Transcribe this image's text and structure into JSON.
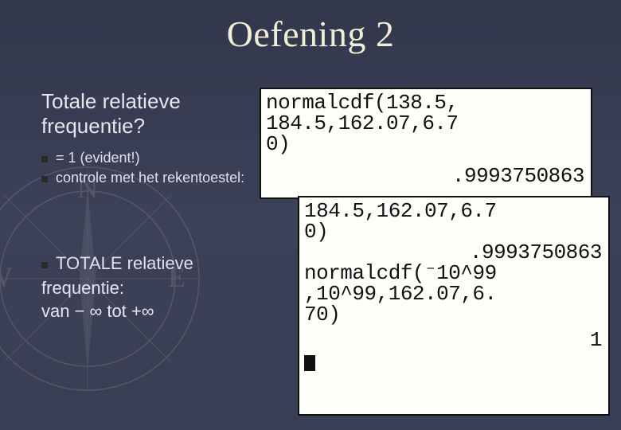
{
  "title": "Oefening 2",
  "subtitle": "Totale relatieve frequentie?",
  "bullets": {
    "b1": "= 1 (evident!)",
    "b2": "controle met het rekentoestel:"
  },
  "totale": {
    "line1": "TOTALE relatieve",
    "line2": "frequentie:",
    "line3": "van − ∞ tot +∞"
  },
  "calc1": {
    "l1": "normalcdf(138.5,",
    "l2": "184.5,162.07,6.7",
    "l3": "0)",
    "result": ".9993750863"
  },
  "calc2": {
    "l1": "184.5,162.07,6.7",
    "l2": "0)",
    "result1": ".9993750863",
    "l3": "normalcdf(⁻10^99",
    "l4": ",10^99,162.07,6.",
    "l5": "70)",
    "result2": "1"
  }
}
